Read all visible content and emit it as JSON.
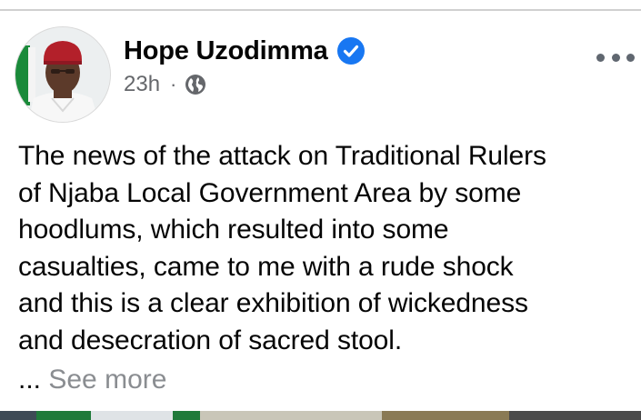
{
  "post": {
    "author_name": "Hope Uzodimma",
    "verified_icon": "verified-badge-icon",
    "timestamp": "23h",
    "separator": "·",
    "audience_icon": "globe-icon",
    "more_icon": "more-options-icon",
    "text_lines": [
      "The news of the attack on Traditional Rulers",
      "of Njaba Local Government Area by some",
      "hoodlums, which resulted into some",
      "casualties, came to me with a rude shock",
      "and this is a clear exhibition of wickedness",
      "and desecration of sacred stool."
    ],
    "ellipsis": "...",
    "see_more_label": "See more"
  },
  "colors": {
    "verified_blue": "#1877f2",
    "meta_gray": "#65676b",
    "see_more_gray": "#8a8d91",
    "text_black": "#050505"
  }
}
